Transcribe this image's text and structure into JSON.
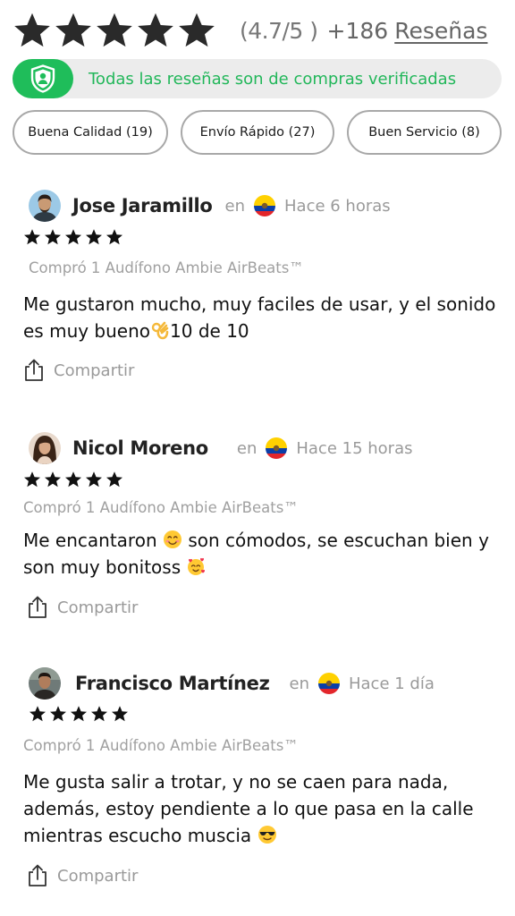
{
  "summary": {
    "star_count": 5,
    "rating_text": "(4.7/5 )",
    "count_text": "+186",
    "reviews_link": "Reseñas"
  },
  "verified_banner": {
    "icon": "shield-user-icon",
    "text": "Todas las reseñas son de compras verificadas",
    "accent_color": "#1fbd5a"
  },
  "filters": [
    {
      "label": "Buena Calidad (19)"
    },
    {
      "label": "Envío Rápido (27)"
    },
    {
      "label": "Buen Servicio (8)"
    }
  ],
  "reviews": [
    {
      "name": "Jose Jaramillo",
      "preposition": "en",
      "country_flag": "ecuador-flag-icon",
      "time": "Hace 6 horas",
      "rating": 5,
      "product": "Compró 1 Audífono Ambie AirBeats™",
      "body_part1": "Me gustaron mucho, muy faciles de usar, y el sonido es muy bueno",
      "emoji1": "ok-hand-emoji",
      "body_part2": "10 de 10",
      "share_label": "Compartir"
    },
    {
      "name": "Nicol Moreno",
      "preposition": "en",
      "country_flag": "ecuador-flag-icon",
      "time": "Hace 15 horas",
      "rating": 5,
      "product": "Compró 1 Audífono Ambie AirBeats™",
      "body_part1": "Me encantaron ",
      "emoji1": "smiling-face-emoji",
      "body_part2": " son cómodos, se escuchan bien y son muy bonitoss ",
      "emoji2": "smiling-face-with-hearts-emoji",
      "share_label": "Compartir"
    },
    {
      "name": "Francisco Martínez",
      "preposition": "en",
      "country_flag": "ecuador-flag-icon",
      "time": "Hace 1 día",
      "rating": 5,
      "product": "Compró 1 Audífono Ambie AirBeats™",
      "body_part1": "Me gusta salir a trotar, y no se caen para nada, además, estoy pendiente a lo que pasa en la calle mientras escucho muscia ",
      "emoji1": "sunglasses-face-emoji",
      "share_label": "Compartir"
    }
  ]
}
